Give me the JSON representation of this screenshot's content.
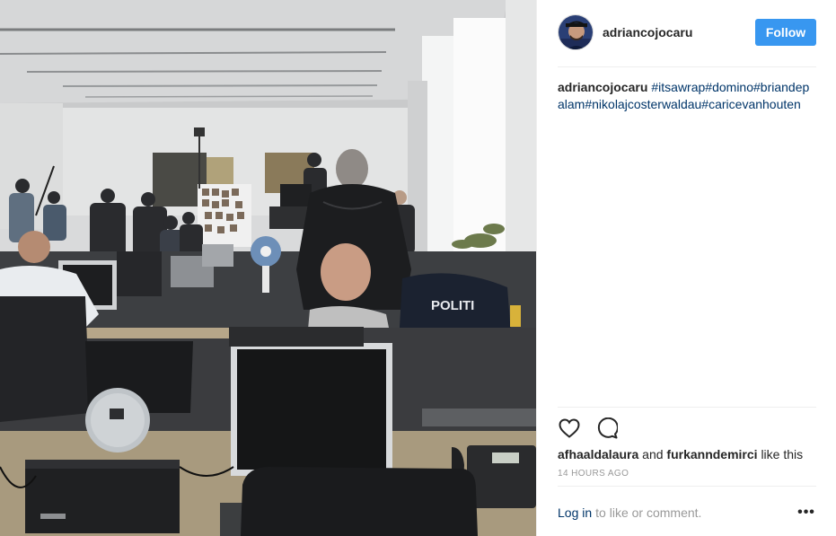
{
  "post": {
    "username": "adriancojocaru",
    "follow_label": "Follow",
    "caption_author": "adriancojocaru",
    "caption_text": "#itsawrap#domino#briandepalam#nikolajcosterwaldau#caricevanhouten",
    "likers": [
      "afhaaldalaura",
      "furkanndemirci"
    ],
    "likes_joiner": "and",
    "likes_suffix": "like this",
    "timestamp": "14 HOURS AGO",
    "login_label": "Log in",
    "comment_hint": "to like or comment.",
    "more_label": "•••",
    "jacket_text": "POLITI"
  },
  "icons": {
    "like": "heart-outline-icon",
    "comment": "speech-bubble-icon",
    "more": "ellipsis-icon"
  },
  "colors": {
    "follow_button": "#3897f0",
    "link": "#003569",
    "muted": "#999999",
    "divider": "#efefef"
  }
}
